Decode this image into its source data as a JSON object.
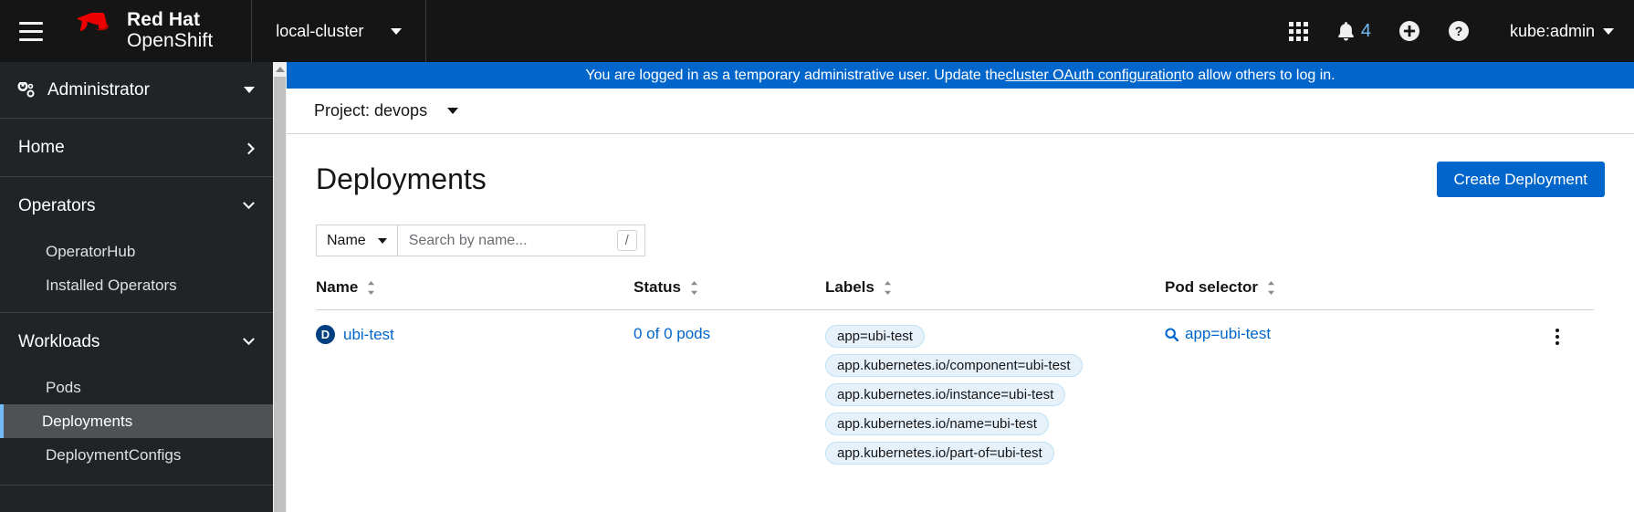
{
  "masthead": {
    "menu_toggle": "hamburger-menu",
    "brand_line1": "Red Hat",
    "brand_line2": "OpenShift",
    "cluster": "local-cluster",
    "app_launcher": "application-launcher",
    "notifications_count": "4",
    "plus_label": "import-yaml",
    "help_label": "help",
    "username": "kube:admin"
  },
  "sidebar": {
    "perspective": "Administrator",
    "groups": [
      {
        "label": "Home",
        "expanded": false,
        "items": []
      },
      {
        "label": "Operators",
        "expanded": true,
        "items": [
          {
            "label": "OperatorHub",
            "active": false
          },
          {
            "label": "Installed Operators",
            "active": false
          }
        ]
      },
      {
        "label": "Workloads",
        "expanded": true,
        "items": [
          {
            "label": "Pods",
            "active": false
          },
          {
            "label": "Deployments",
            "active": true
          },
          {
            "label": "DeploymentConfigs",
            "active": false
          }
        ]
      }
    ]
  },
  "banner": {
    "text_before": "You are logged in as a temporary administrative user. Update the ",
    "link": "cluster OAuth configuration",
    "text_after": " to allow others to log in."
  },
  "project_bar": {
    "label": "Project: devops"
  },
  "page": {
    "title": "Deployments",
    "create_button": "Create Deployment"
  },
  "toolbar": {
    "filter_attribute": "Name",
    "search_placeholder": "Search by name...",
    "search_value": "",
    "shortcut_key": "/"
  },
  "table": {
    "columns": [
      {
        "label": "Name",
        "sortable": true
      },
      {
        "label": "Status",
        "sortable": true
      },
      {
        "label": "Labels",
        "sortable": true
      },
      {
        "label": "Pod selector",
        "sortable": true
      }
    ],
    "rows": [
      {
        "badge": "D",
        "name": "ubi-test",
        "status": "0 of 0 pods",
        "labels": [
          "app=ubi-test",
          "app.kubernetes.io/component=ubi-test",
          "app.kubernetes.io/instance=ubi-test",
          "app.kubernetes.io/name=ubi-test",
          "app.kubernetes.io/part-of=ubi-test"
        ],
        "pod_selector": "app=ubi-test"
      }
    ]
  },
  "colors": {
    "masthead_bg": "#151515",
    "sidebar_bg": "#212427",
    "active_item_bg": "#4f5255",
    "accent_blue": "#0066cc",
    "link_blue": "#0066cc",
    "banner_bg": "#0066cc",
    "badge_blue": "#004080",
    "chip_bg": "#e7f1fa"
  }
}
